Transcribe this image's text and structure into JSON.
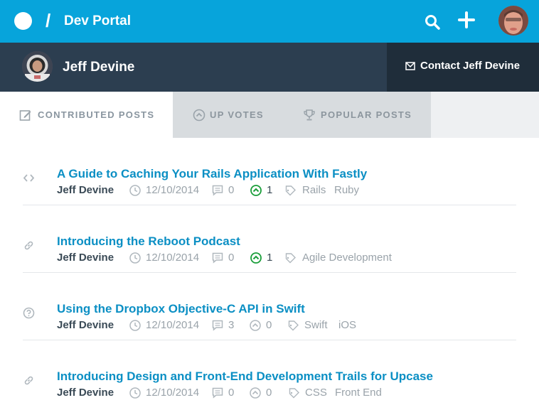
{
  "header": {
    "separator": "/",
    "title": "Dev Portal"
  },
  "profile": {
    "name": "Jeff Devine",
    "contact_label": "Contact Jeff Devine"
  },
  "tabs": [
    {
      "label": "CONTRIBUTED POSTS",
      "icon": "pencil-square-icon",
      "active": true
    },
    {
      "label": "UP VOTES",
      "icon": "upvote-circle-icon",
      "active": false
    },
    {
      "label": "POPULAR POSTS",
      "icon": "trophy-icon",
      "active": false
    }
  ],
  "posts": [
    {
      "type_icon": "code-icon",
      "title": "A Guide to Caching Your Rails Application With Fastly",
      "author": "Jeff Devine",
      "date": "12/10/2014",
      "comments": "0",
      "votes": "1",
      "voted": true,
      "tags": [
        "Rails",
        "Ruby"
      ]
    },
    {
      "type_icon": "link-icon",
      "title": "Introducing the Reboot Podcast",
      "author": "Jeff Devine",
      "date": "12/10/2014",
      "comments": "0",
      "votes": "1",
      "voted": true,
      "tags": [
        "Agile Development"
      ]
    },
    {
      "type_icon": "question-icon",
      "title": "Using the Dropbox Objective-C API in Swift",
      "author": "Jeff Devine",
      "date": "12/10/2014",
      "comments": "3",
      "votes": "0",
      "voted": false,
      "tags": [
        "Swift",
        "iOS"
      ]
    },
    {
      "type_icon": "link-icon",
      "title": "Introducing Design and Front-End Development Trails for Upcase",
      "author": "Jeff Devine",
      "date": "12/10/2014",
      "comments": "0",
      "votes": "0",
      "voted": false,
      "tags": [
        "CSS",
        "Front End"
      ]
    }
  ],
  "colors": {
    "brand": "#07a4db",
    "profile_bar": "#2c3e50",
    "link": "#0b8fc4",
    "upvote_active": "#1a9e3a"
  }
}
